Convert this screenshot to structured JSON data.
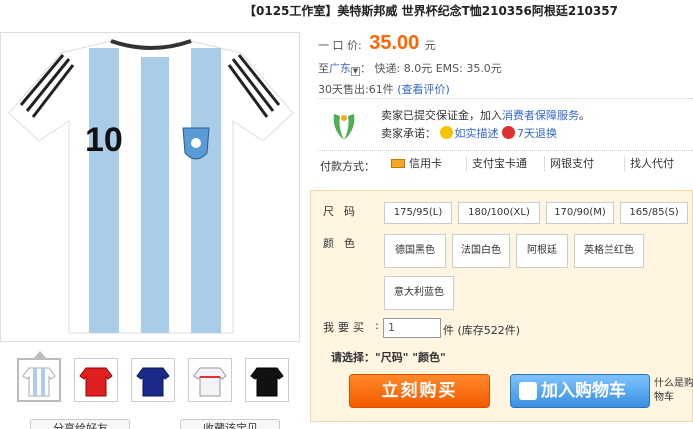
{
  "title": "【0125工作室】美特斯邦威 世界杯纪念T恤210356阿根廷210357",
  "price": {
    "label": "一 口 价:",
    "value": "35.00",
    "unit": "元"
  },
  "shipping": {
    "to_label": "至",
    "region": "广东",
    "express": "快递: 8.0元  EMS: 35.0元"
  },
  "sold": {
    "label": "30天售出:",
    "count": "61件",
    "link": "(查看评价)"
  },
  "trust": {
    "line1_prefix": "卖家已提交保证金，加入",
    "line1_link": "消费者保障服务",
    "line1_suffix": "。",
    "line2_label": "卖家承诺：",
    "promise1": "如实描述",
    "promise2": "7天退换"
  },
  "payment": {
    "label": "付款方式：",
    "options": [
      "信用卡",
      "支付宝卡通",
      "网银支付",
      "找人代付"
    ]
  },
  "sku": {
    "size_label": "尺码",
    "sizes": [
      "175/95(L)",
      "180/100(XL)",
      "170/90(M)",
      "165/85(S)"
    ],
    "color_label": "颜色",
    "colors": [
      "德国黑色",
      "法国白色",
      "阿根廷",
      "英格兰红色",
      "意大利蓝色"
    ],
    "qty_label": "我要买",
    "qty_value": "1",
    "qty_note": "件 (库存522件)",
    "select_tip": "请选择：\"尺码\" \"颜色\""
  },
  "buttons": {
    "buy": "立刻购买",
    "cart": "加入购物车",
    "what_cart": "什么是购物车"
  },
  "bottom": {
    "share": "分享给好友",
    "collect": "收藏该宝贝"
  },
  "jersey_number": "10",
  "colors": {
    "price": "#ff6600",
    "link": "#3366cc",
    "buy": "#f35a00",
    "cart": "#3a8fe0"
  }
}
